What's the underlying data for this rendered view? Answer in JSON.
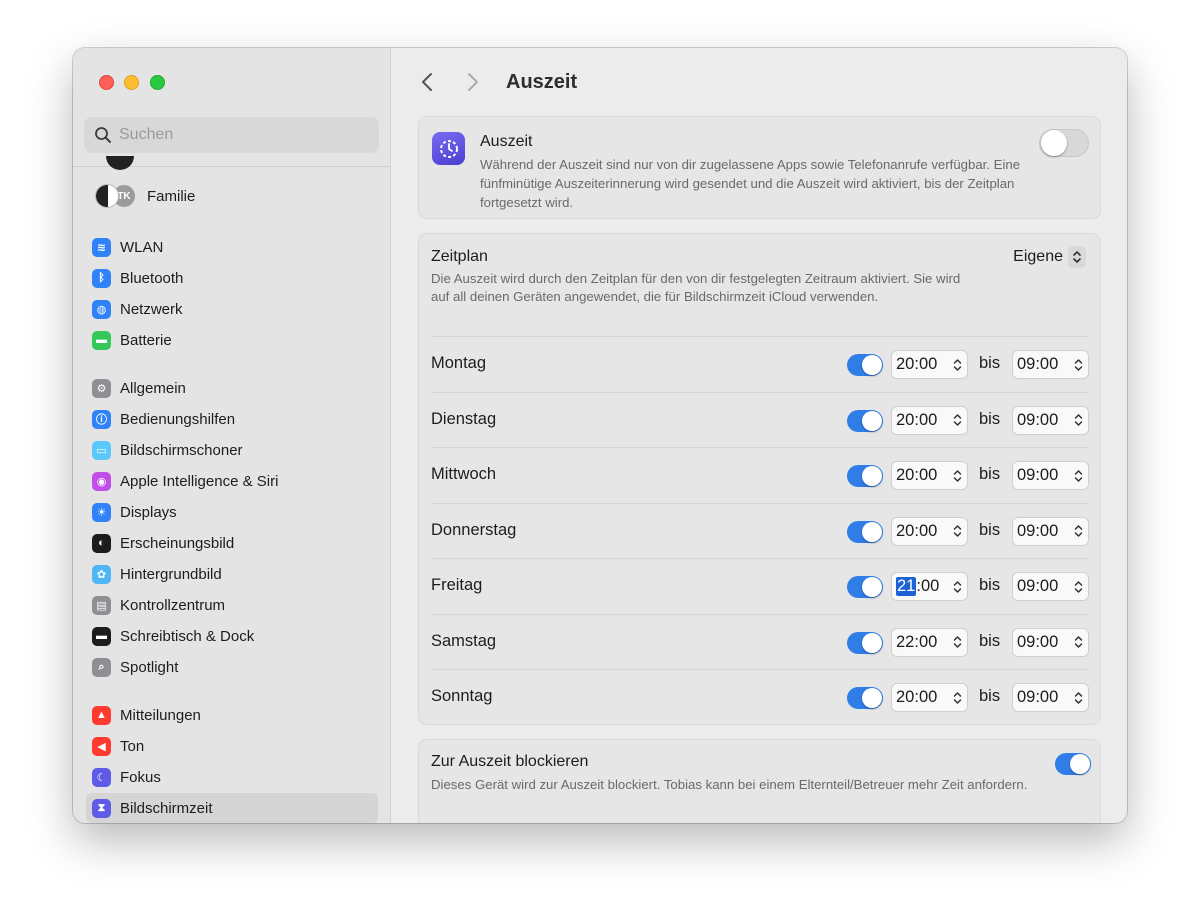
{
  "sidebar": {
    "search_placeholder": "Suchen",
    "family": {
      "avatar_initials": "TK",
      "label": "Familie"
    },
    "groups": [
      [
        {
          "label": "WLAN",
          "icon": "wifi-icon",
          "color": "#2f82f7"
        },
        {
          "label": "Bluetooth",
          "icon": "bluetooth-icon",
          "color": "#2f82f7"
        },
        {
          "label": "Netzwerk",
          "icon": "globe-icon",
          "color": "#2f82f7"
        },
        {
          "label": "Batterie",
          "icon": "battery-icon",
          "color": "#35c759"
        }
      ],
      [
        {
          "label": "Allgemein",
          "icon": "gear-icon",
          "color": "#8e8e93"
        },
        {
          "label": "Bedienungshilfen",
          "icon": "accessibility-icon",
          "color": "#2f82f7"
        },
        {
          "label": "Bildschirmschoner",
          "icon": "screensaver-icon",
          "color": "#5ac8fa"
        },
        {
          "label": "Apple Intelligence & Siri",
          "icon": "siri-icon",
          "color": "#c04ee8"
        },
        {
          "label": "Displays",
          "icon": "sun-icon",
          "color": "#2f82f7"
        },
        {
          "label": "Erscheinungsbild",
          "icon": "appearance-icon",
          "color": "#1c1c1e"
        },
        {
          "label": "Hintergrundbild",
          "icon": "flower-icon",
          "color": "#4fb6f5"
        },
        {
          "label": "Kontrollzentrum",
          "icon": "controls-icon",
          "color": "#8e8e93"
        },
        {
          "label": "Schreibtisch & Dock",
          "icon": "dock-icon",
          "color": "#1c1c1e"
        },
        {
          "label": "Spotlight",
          "icon": "magnifier-icon",
          "color": "#8e8e93"
        }
      ],
      [
        {
          "label": "Mitteilungen",
          "icon": "bell-icon",
          "color": "#ff3b30"
        },
        {
          "label": "Ton",
          "icon": "speaker-icon",
          "color": "#ff3b30"
        },
        {
          "label": "Fokus",
          "icon": "moon-icon",
          "color": "#5e5ce6"
        },
        {
          "label": "Bildschirmzeit",
          "icon": "hourglass-icon",
          "color": "#5e5ce6",
          "active": true
        }
      ]
    ]
  },
  "header": {
    "title": "Auszeit"
  },
  "auszeit_card": {
    "title": "Auszeit",
    "description": "Während der Auszeit sind nur von dir zugelassene Apps sowie Telefonanrufe verfügbar. Eine fünfminütige Auszeiterinnerung wird gesendet und die Auszeit wird aktiviert, bis der Zeitplan fortgesetzt wird.",
    "enabled": false
  },
  "schedule_card": {
    "title": "Zeitplan",
    "description": "Die Auszeit wird durch den Zeitplan für den von dir festgelegten Zeitraum aktiviert. Sie wird auf all deinen Geräten angewendet, die für Bildschirmzeit iCloud verwenden.",
    "mode": "Eigene",
    "separator_label": "bis",
    "days": [
      {
        "day": "Montag",
        "enabled": true,
        "start_hour": "20",
        "start_min": "00",
        "end": "09:00"
      },
      {
        "day": "Dienstag",
        "enabled": true,
        "start_hour": "20",
        "start_min": "00",
        "end": "09:00"
      },
      {
        "day": "Mittwoch",
        "enabled": true,
        "start_hour": "20",
        "start_min": "00",
        "end": "09:00"
      },
      {
        "day": "Donnerstag",
        "enabled": true,
        "start_hour": "20",
        "start_min": "00",
        "end": "09:00"
      },
      {
        "day": "Freitag",
        "enabled": true,
        "start_hour": "21",
        "start_min": "00",
        "end": "09:00",
        "hour_selected": true
      },
      {
        "day": "Samstag",
        "enabled": true,
        "start_hour": "22",
        "start_min": "00",
        "end": "09:00"
      },
      {
        "day": "Sonntag",
        "enabled": true,
        "start_hour": "20",
        "start_min": "00",
        "end": "09:00"
      }
    ]
  },
  "block_card": {
    "title": "Zur Auszeit blockieren",
    "description": "Dieses Gerät wird zur Auszeit blockiert. Tobias kann bei einem Elternteil/Betreuer mehr Zeit anfordern.",
    "enabled": true
  }
}
